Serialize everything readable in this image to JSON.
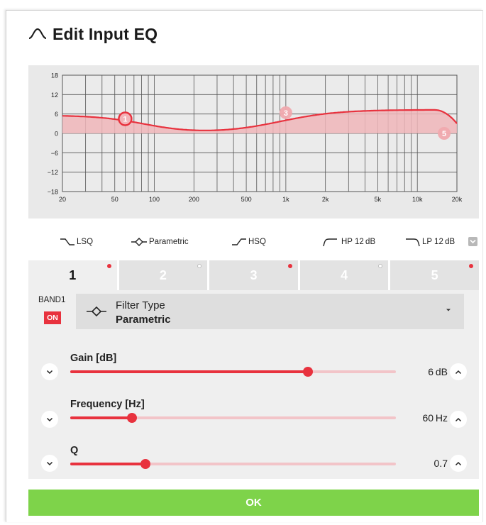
{
  "dialog": {
    "title": "Edit Input EQ"
  },
  "graph": {
    "y_ticks": [
      "18",
      "12",
      "6",
      "0",
      "−6",
      "−12",
      "−18"
    ],
    "x_ticks": [
      "20",
      "50",
      "100",
      "200",
      "500",
      "1k",
      "2k",
      "5k",
      "10k",
      "20k"
    ],
    "band_markers": [
      "1",
      "3",
      "5"
    ],
    "curve_color": "#e8323e",
    "fill_color": "#f0b6ba"
  },
  "filter_options": [
    {
      "label": "LSQ",
      "icon": "low-shelf-icon"
    },
    {
      "label": "Parametric",
      "icon": "parametric-icon"
    },
    {
      "label": "HSQ",
      "icon": "high-shelf-icon"
    },
    {
      "label": "HP 12 dB",
      "icon": "high-pass-icon"
    },
    {
      "label": "LP 12 dB",
      "icon": "low-pass-icon"
    }
  ],
  "tabs": [
    {
      "label": "1",
      "indicator": "red"
    },
    {
      "label": "2",
      "indicator": "grey"
    },
    {
      "label": "3",
      "indicator": "red"
    },
    {
      "label": "4",
      "indicator": "grey"
    },
    {
      "label": "5",
      "indicator": "red"
    }
  ],
  "band": {
    "label": "BAND1",
    "on_label": "ON",
    "filter_type_label": "Filter Type",
    "filter_type_value": "Parametric",
    "params": [
      {
        "title": "Gain [dB]",
        "value": "6 dB",
        "level": 0.73
      },
      {
        "title": "Frequency [Hz]",
        "value": "60 Hz",
        "level": 0.19
      },
      {
        "title": "Q",
        "value": "0.7",
        "level": 0.23
      }
    ]
  },
  "ok_label": "OK",
  "colors": {
    "accent": "#e8323e",
    "ok": "#7ed34a"
  }
}
